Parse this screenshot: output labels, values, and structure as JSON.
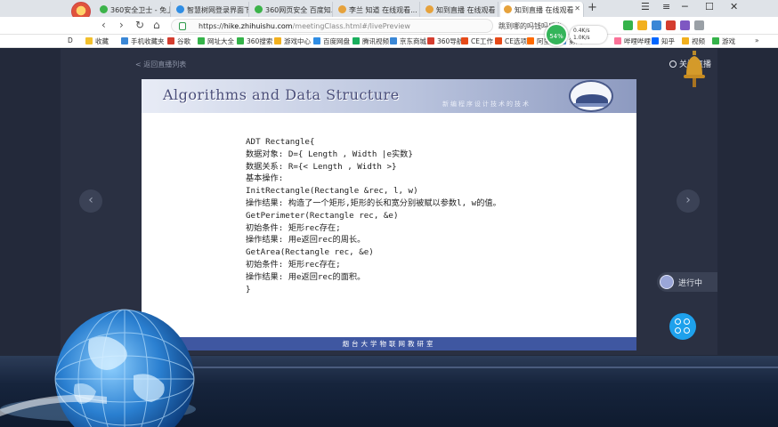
{
  "browser": {
    "tabs": [
      {
        "label": "360安全卫士 - 免上..."
      },
      {
        "label": "智慧树网登录界面下..."
      },
      {
        "label": "360网页安全 百度知..."
      },
      {
        "label": "李兰 知道 在线观看..."
      },
      {
        "label": "知到直播 在线观看"
      },
      {
        "label": "知到直播 在线观看"
      }
    ],
    "url_host": "hike.zhihuishu.com",
    "url_path": "/meetingClass.html#/livePreview",
    "search_text": "跳到哪的吗钱吗后台",
    "perf_value": "54%",
    "net_up": "0.4K/s",
    "net_down": "1.0K/s",
    "bookmarks": [
      "收藏",
      "手机收藏夹",
      "谷歌",
      "网址大全",
      "360搜索",
      "游戏中心",
      "百度网盘",
      "腾讯视频",
      "京东商城",
      "360导航",
      "CE工作",
      "CE选项",
      "阿里云",
      "第四",
      "哔哩哔哩",
      "知乎",
      "视频",
      "游戏"
    ]
  },
  "live": {
    "back_label": "< 返回直播列表",
    "close_label": "关闭直播",
    "status_label": "进行中"
  },
  "slide": {
    "title": "Algorithms and Data Structure",
    "subtitle": "新编程序设计技术的技术",
    "footer": "烟台大学物联网教研室",
    "lines": [
      "ADT Rectangle{",
      "数据对象: D={ Length , Width |e实数}",
      "数据关系: R={< Length , Width >}",
      "基本操作:",
      "InitRectangle(Rectangle &rec, l, w)",
      "操作结果: 构造了一个矩形,矩形的长和宽分别被赋以参数l, w的值。",
      "GetPerimeter(Rectangle rec, &e)",
      "初始条件: 矩形rec存在;",
      "操作结果: 用e返回rec的周长。",
      "GetArea(Rectangle rec, &e)",
      "初始条件: 矩形rec存在;",
      "操作结果: 用e返回rec的面积。",
      "}"
    ]
  },
  "colors": {
    "accent": "#1ea1ec",
    "slide_footer": "#3f57a1",
    "slide_title": "#4a4e7a"
  }
}
